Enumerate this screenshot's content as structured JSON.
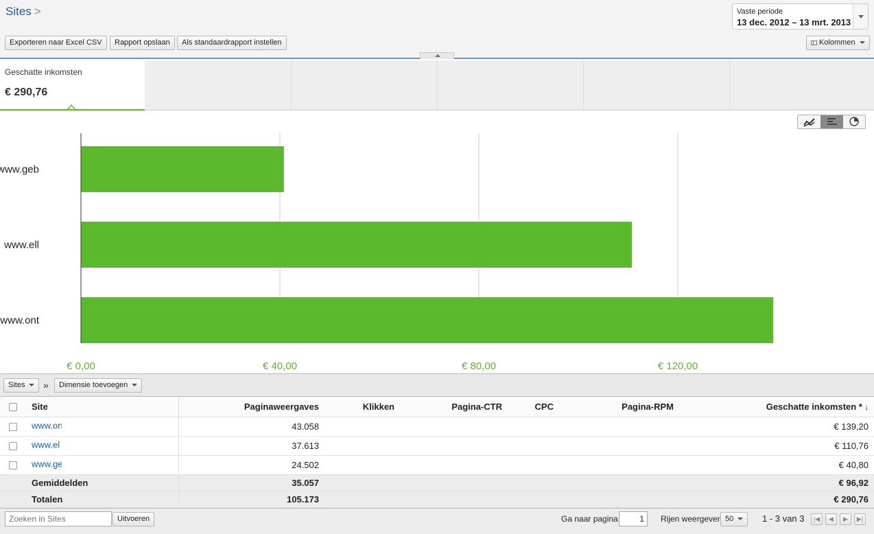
{
  "breadcrumb": {
    "title": "Sites",
    "separator": ">"
  },
  "period": {
    "label": "Vaste periode",
    "range": "13 dec. 2012 – 13 mrt. 2013"
  },
  "toolbar": {
    "export_label": "Exporteren naar Excel CSV",
    "save_label": "Rapport opslaan",
    "default_label": "Als standaardrapport instellen",
    "columns_label": "Kolommen"
  },
  "scorecard": {
    "title": "Geschatte inkomsten",
    "value": "€ 290,76"
  },
  "colors": {
    "accent": "#5cb82c",
    "link": "#1a5fb4",
    "header_border": "#6e8ec8"
  },
  "chart_data": {
    "type": "bar",
    "orientation": "horizontal",
    "categories": [
      "www.ge",
      "www.ell",
      "www.on"
    ],
    "values": [
      40.8,
      110.76,
      139.2
    ],
    "xlim": [
      0,
      140
    ],
    "xticks": [
      0,
      40,
      80,
      120
    ],
    "xtick_labels": [
      "€ 0,00",
      "€ 40,00",
      "€ 80,00",
      "€ 120,00"
    ],
    "grid": true,
    "color": "#5cb82c"
  },
  "chart_labels": [
    "www.geb",
    "www.ell",
    "www.ont"
  ],
  "dimension": {
    "dropdown_label": "Sites",
    "add_label": "Dimensie toevoegen",
    "arrow": "»"
  },
  "table": {
    "headers": {
      "site": "Site",
      "pageviews": "Paginaweergaves",
      "clicks": "Klikken",
      "ctr": "Pagina-CTR",
      "cpc": "CPC",
      "rpm": "Pagina-RPM",
      "earnings": "Geschatte inkomsten *"
    },
    "rows": [
      {
        "site": "www.on",
        "pageviews": "43.058",
        "earnings": "€ 139,20"
      },
      {
        "site": "www.ell",
        "pageviews": "37.613",
        "earnings": "€ 110,76"
      },
      {
        "site": "www.ge",
        "pageviews": "24.502",
        "earnings": "€ 40,80"
      }
    ],
    "averages": {
      "label": "Gemiddelden",
      "pageviews": "35.057",
      "earnings": "€ 96,92"
    },
    "totals": {
      "label": "Totalen",
      "pageviews": "105.173",
      "earnings": "€ 290,76"
    }
  },
  "footer": {
    "search_placeholder": "Zoeken in Sites",
    "run_label": "Uitvoeren",
    "goto_label": "Ga naar pagina:",
    "page_value": "1",
    "rows_label": "Rijen weergeven:",
    "rows_value": "50",
    "range_text": "1 - 3 van 3"
  }
}
